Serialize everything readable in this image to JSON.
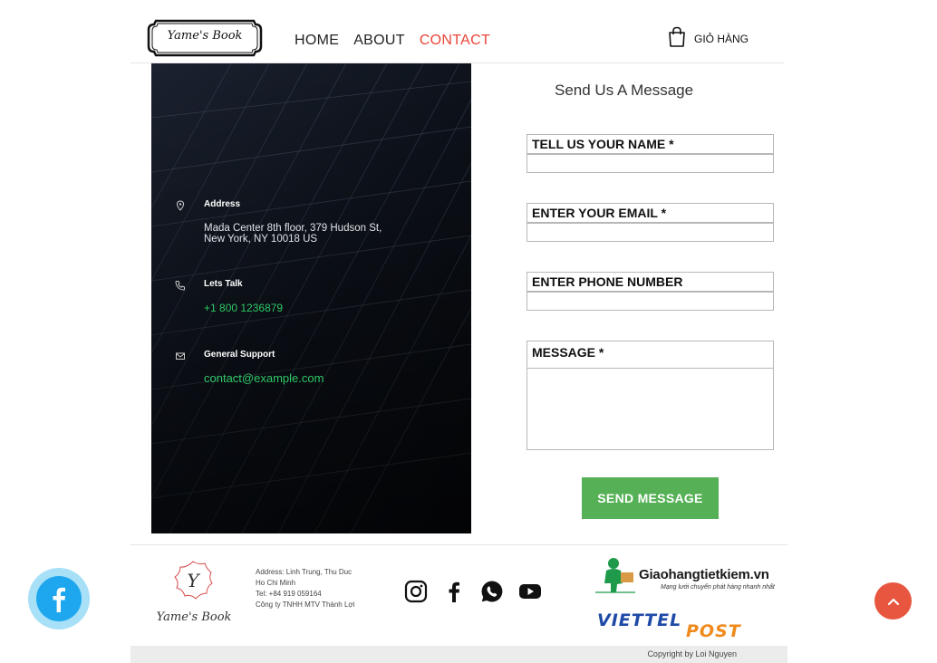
{
  "header": {
    "logo_text": "Yame's Book",
    "nav": [
      {
        "label": "HOME",
        "active": false
      },
      {
        "label": "ABOUT",
        "active": false
      },
      {
        "label": "CONTACT",
        "active": true
      }
    ],
    "cart_label": "GIỎ HÀNG"
  },
  "contact_info": {
    "address_label": "Address",
    "address_value_1": "Mada Center 8th floor, 379 Hudson St,",
    "address_value_2": "New York, NY 10018 US",
    "talk_label": "Lets Talk",
    "talk_value": "+1 800 1236879",
    "support_label": "General Support",
    "support_value": "contact@example.com"
  },
  "form": {
    "title": "Send Us A Message",
    "name_label": "TELL US YOUR NAME *",
    "email_label": "ENTER YOUR EMAIL *",
    "phone_label": "ENTER PHONE NUMBER",
    "message_label": "MESSAGE *",
    "name_value": "",
    "email_value": "",
    "phone_value": "",
    "message_value": "",
    "submit_label": "SEND MESSAGE"
  },
  "footer": {
    "brand_name": "Yame's Book",
    "address_line_1": "Address: Linh Trung, Thu Duc",
    "address_line_2": "Ho Chi Minh",
    "tel": "Tel: +84 919 059164",
    "company": "Công ty TNHH MTV Thành Lợi",
    "socials": [
      "instagram-icon",
      "facebook-icon",
      "whatsapp-icon",
      "youtube-icon"
    ],
    "partner_ghtk_name": "Giaohangtietkiem.vn",
    "partner_ghtk_tagline": "Mạng lưới chuyển phát hàng nhanh nhất",
    "partner_viettel_a": "VIETTEL",
    "partner_viettel_b": "POST",
    "copyright": "Copyright by Loi Nguyen"
  },
  "colors": {
    "accent": "#e8453a",
    "button_green": "#56b156",
    "link_green": "#2ec866",
    "facebook_blue": "#1ea7ef",
    "to_top": "#e8563f"
  }
}
